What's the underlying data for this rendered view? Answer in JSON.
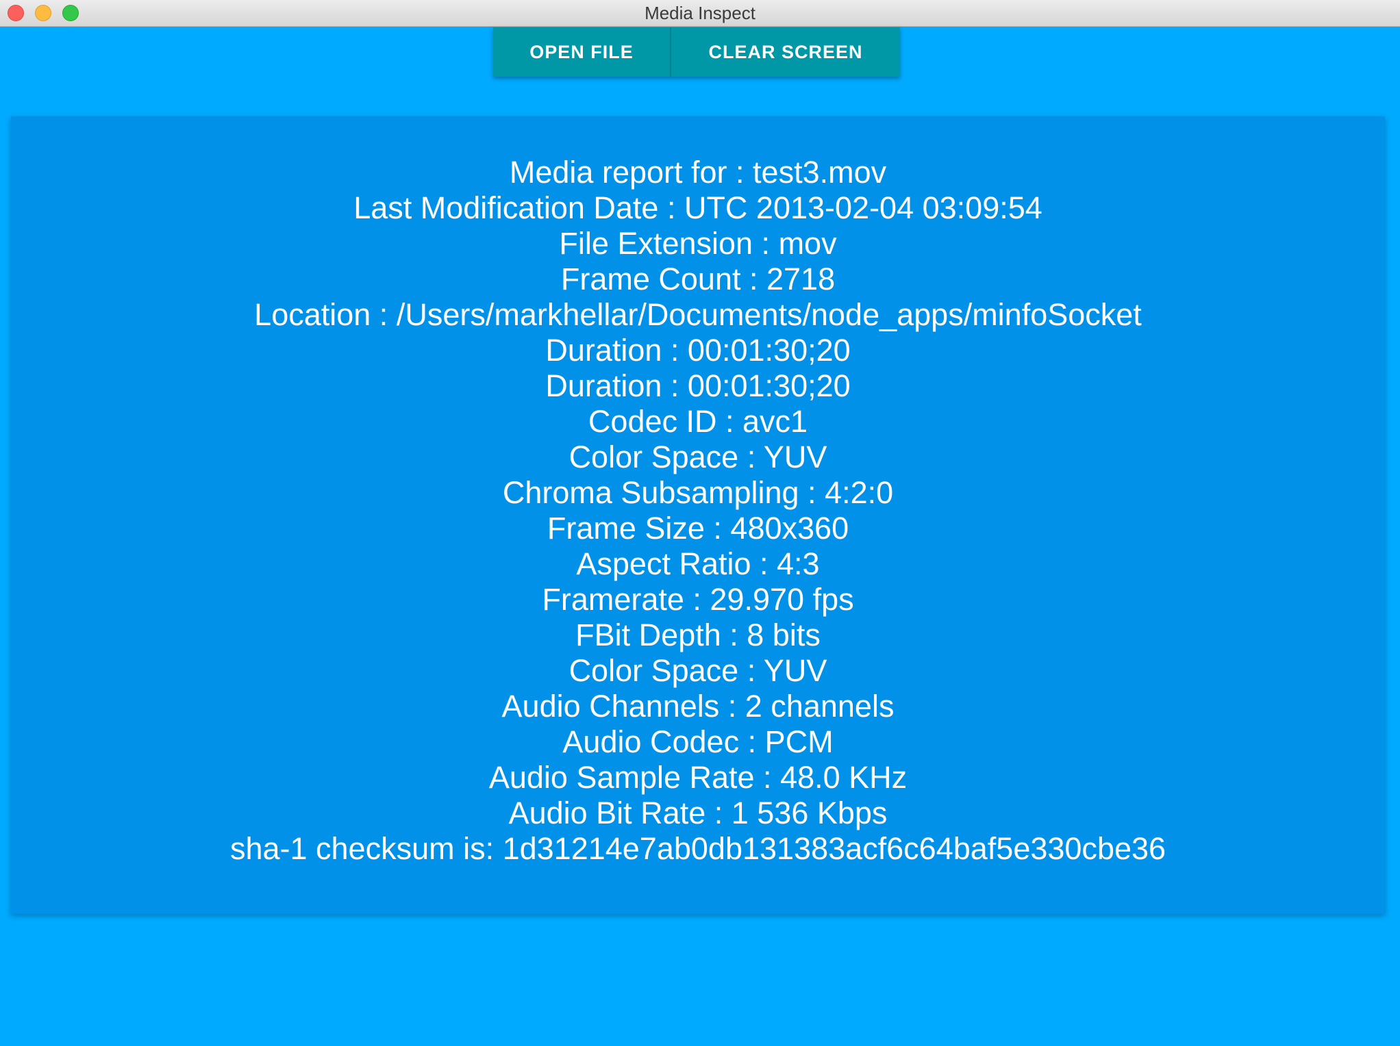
{
  "window": {
    "title": "Media Inspect"
  },
  "toolbar": {
    "open_file_label": "OPEN FILE",
    "clear_screen_label": "CLEAR SCREEN"
  },
  "colors": {
    "background": "#00aaff",
    "card": "#0291e8",
    "button": "#0097a7"
  },
  "report": {
    "lines": [
      "Media report for : test3.mov",
      "Last Modification Date : UTC 2013-02-04 03:09:54",
      "File Extension : mov",
      "Frame Count : 2718",
      "Location : /Users/markhellar/Documents/node_apps/minfoSocket",
      "Duration : 00:01:30;20",
      "Duration : 00:01:30;20",
      "Codec ID : avc1",
      "Color Space : YUV",
      "Chroma Subsampling : 4:2:0",
      "Frame Size : 480x360",
      "Aspect Ratio : 4:3",
      "Framerate : 29.970 fps",
      "FBit Depth : 8 bits",
      "Color Space : YUV",
      "Audio Channels : 2 channels",
      "Audio Codec : PCM",
      "Audio Sample Rate : 48.0 KHz",
      "Audio Bit Rate : 1 536 Kbps",
      "sha-1 checksum is: 1d31214e7ab0db131383acf6c64baf5e330cbe36"
    ]
  }
}
